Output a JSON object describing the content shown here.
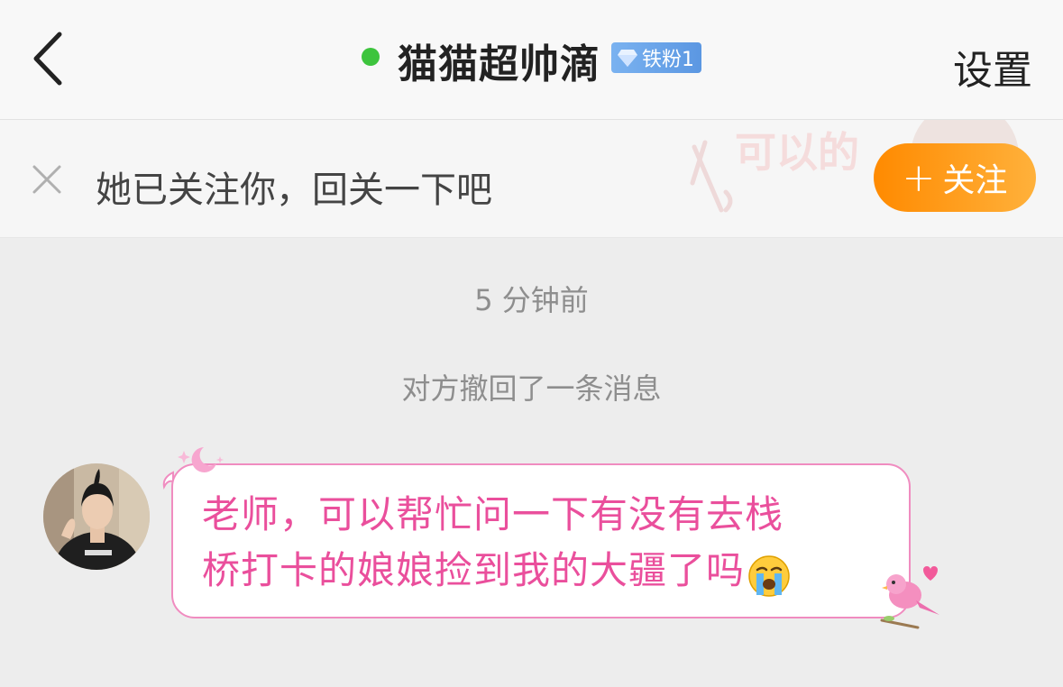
{
  "nav": {
    "nickname": "猫猫超帅滴",
    "online": true,
    "badge": "铁粉1",
    "settings_label": "设置",
    "back_icon": "chevron-left-icon"
  },
  "follow_banner": {
    "text": "她已关注你，回关一下吧",
    "button_label": "关注",
    "button_plus": "+",
    "close_icon": "close-icon",
    "background_text": "可以的"
  },
  "chat": {
    "timestamp": "5 分钟前",
    "recall_note": "对方撤回了一条消息",
    "messages": [
      {
        "sender": "other",
        "text": "老师，可以帮忙问一下有没有去栈\n桥打卡的娘娘捡到我的大疆了吗",
        "emoji": "loudly-crying-face-icon"
      }
    ]
  },
  "colors": {
    "online_dot": "#3dc43d",
    "badge_bg": "#6aa3e8",
    "follow_btn_start": "#ff8a00",
    "follow_btn_end": "#ffb13b",
    "bubble_border": "#f08cc0",
    "bubble_text": "#ea4f9c"
  }
}
